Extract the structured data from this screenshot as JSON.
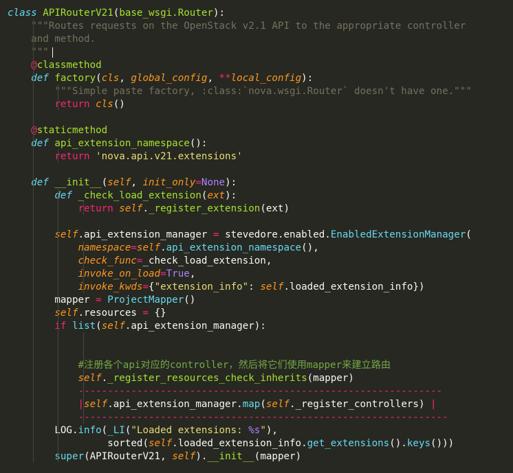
{
  "code_lines": [
    [
      [
        "kw",
        "class"
      ],
      [
        "plain",
        " "
      ],
      [
        "cls",
        "APIRouterV21"
      ],
      [
        "plain",
        "("
      ],
      [
        "cls",
        "base_wsgi.Router"
      ],
      [
        "plain",
        "):"
      ]
    ],
    [
      [
        "plain",
        "    "
      ],
      [
        "doc",
        "\"\"\"Routes requests on the OpenStack v2.1 API to the appropriate controller"
      ]
    ],
    [
      [
        "plain",
        "    "
      ],
      [
        "doc",
        "and method."
      ]
    ],
    [
      [
        "plain",
        "    "
      ],
      [
        "doc",
        "\"\"\""
      ]
    ],
    [
      [
        "plain",
        "    "
      ],
      [
        "deco",
        "@"
      ],
      [
        "decoName",
        "classmethod"
      ]
    ],
    [
      [
        "plain",
        "    "
      ],
      [
        "kw",
        "def"
      ],
      [
        "plain",
        " "
      ],
      [
        "fn",
        "factory"
      ],
      [
        "plain",
        "("
      ],
      [
        "param",
        "cls"
      ],
      [
        "plain",
        ", "
      ],
      [
        "param",
        "global_config"
      ],
      [
        "plain",
        ", "
      ],
      [
        "op",
        "**"
      ],
      [
        "param",
        "local_config"
      ],
      [
        "plain",
        "):"
      ]
    ],
    [
      [
        "plain",
        "        "
      ],
      [
        "doc",
        "\"\"\"Simple paste factory, :class:`nova.wsgi.Router` doesn't have one.\"\"\""
      ]
    ],
    [
      [
        "plain",
        "        "
      ],
      [
        "ctl",
        "return"
      ],
      [
        "plain",
        " "
      ],
      [
        "self",
        "cls"
      ],
      [
        "plain",
        "()"
      ]
    ],
    [],
    [
      [
        "plain",
        "    "
      ],
      [
        "deco",
        "@"
      ],
      [
        "decoName",
        "staticmethod"
      ]
    ],
    [
      [
        "plain",
        "    "
      ],
      [
        "kw",
        "def"
      ],
      [
        "plain",
        " "
      ],
      [
        "fn",
        "api_extension_namespace"
      ],
      [
        "plain",
        "():"
      ]
    ],
    [
      [
        "plain",
        "        "
      ],
      [
        "ctl",
        "return"
      ],
      [
        "plain",
        " "
      ],
      [
        "str",
        "'nova.api.v21.extensions'"
      ]
    ],
    [],
    [
      [
        "plain",
        "    "
      ],
      [
        "kw",
        "def"
      ],
      [
        "plain",
        " "
      ],
      [
        "fn",
        "__init__"
      ],
      [
        "plain",
        "("
      ],
      [
        "param",
        "self"
      ],
      [
        "plain",
        ", "
      ],
      [
        "param",
        "init_only"
      ],
      [
        "op",
        "="
      ],
      [
        "const",
        "None"
      ],
      [
        "plain",
        "):"
      ]
    ],
    [
      [
        "plain",
        "        "
      ],
      [
        "kw",
        "def"
      ],
      [
        "plain",
        " "
      ],
      [
        "fn",
        "_check_load_extension"
      ],
      [
        "plain",
        "("
      ],
      [
        "param",
        "ext"
      ],
      [
        "plain",
        "):"
      ]
    ],
    [
      [
        "plain",
        "            "
      ],
      [
        "ctl",
        "return"
      ],
      [
        "plain",
        " "
      ],
      [
        "self",
        "self"
      ],
      [
        "plain",
        "."
      ],
      [
        "fn",
        "_register_extension"
      ],
      [
        "plain",
        "(ext)"
      ]
    ],
    [],
    [
      [
        "plain",
        "        "
      ],
      [
        "self",
        "self"
      ],
      [
        "plain",
        ".api_extension_manager "
      ],
      [
        "op",
        "="
      ],
      [
        "plain",
        " stevedore.enabled."
      ],
      [
        "method",
        "EnabledExtensionManager"
      ],
      [
        "plain",
        "("
      ]
    ],
    [
      [
        "plain",
        "            "
      ],
      [
        "param",
        "namespace"
      ],
      [
        "op",
        "="
      ],
      [
        "self",
        "self"
      ],
      [
        "plain",
        "."
      ],
      [
        "method",
        "api_extension_namespace"
      ],
      [
        "plain",
        "(),"
      ]
    ],
    [
      [
        "plain",
        "            "
      ],
      [
        "param",
        "check_func"
      ],
      [
        "op",
        "="
      ],
      [
        "plain",
        "_check_load_extension,"
      ]
    ],
    [
      [
        "plain",
        "            "
      ],
      [
        "param",
        "invoke_on_load"
      ],
      [
        "op",
        "="
      ],
      [
        "const",
        "True"
      ],
      [
        "plain",
        ","
      ]
    ],
    [
      [
        "plain",
        "            "
      ],
      [
        "param",
        "invoke_kwds"
      ],
      [
        "op",
        "="
      ],
      [
        "plain",
        "{"
      ],
      [
        "str",
        "\"extension_info\""
      ],
      [
        "plain",
        ": "
      ],
      [
        "self",
        "self"
      ],
      [
        "plain",
        ".loaded_extension_info})"
      ]
    ],
    [
      [
        "plain",
        "        mapper "
      ],
      [
        "op",
        "="
      ],
      [
        "plain",
        " "
      ],
      [
        "method",
        "ProjectMapper"
      ],
      [
        "plain",
        "()"
      ]
    ],
    [
      [
        "plain",
        "        "
      ],
      [
        "self",
        "self"
      ],
      [
        "plain",
        ".resources "
      ],
      [
        "op",
        "="
      ],
      [
        "plain",
        " {}"
      ]
    ],
    [
      [
        "plain",
        "        "
      ],
      [
        "ctl",
        "if"
      ],
      [
        "plain",
        " "
      ],
      [
        "bi",
        "list"
      ],
      [
        "plain",
        "("
      ],
      [
        "self",
        "self"
      ],
      [
        "plain",
        ".api_extension_manager):"
      ]
    ],
    [],
    [],
    [
      [
        "plain",
        "            "
      ],
      [
        "comment",
        "#注册各个api对应的controller，然后将它们使用mapper来建立路由"
      ]
    ],
    [
      [
        "plain",
        "            "
      ],
      [
        "self",
        "self"
      ],
      [
        "plain",
        "."
      ],
      [
        "fn",
        "_register_resources_check_inherits"
      ],
      [
        "plain",
        "(mapper)"
      ]
    ],
    [
      [
        "plain",
        "            "
      ],
      [
        "dash",
        "--------------------------------------------------------------"
      ]
    ],
    [
      [
        "plain",
        "            "
      ],
      [
        "dash",
        "|"
      ],
      [
        "self",
        "self"
      ],
      [
        "plain",
        ".api_extension_manager."
      ],
      [
        "method",
        "map"
      ],
      [
        "plain",
        "("
      ],
      [
        "self",
        "self"
      ],
      [
        "plain",
        "._register_controllers) "
      ],
      [
        "dash",
        "|"
      ]
    ],
    [
      [
        "plain",
        "            "
      ],
      [
        "dash",
        "---------------------------------------------------------------"
      ]
    ],
    [
      [
        "plain",
        "        LOG."
      ],
      [
        "method",
        "info"
      ],
      [
        "plain",
        "("
      ],
      [
        "method",
        "_LI"
      ],
      [
        "plain",
        "("
      ],
      [
        "str",
        "\"Loaded extensions: "
      ],
      [
        "const",
        "%s"
      ],
      [
        "str",
        "\""
      ],
      [
        "plain",
        "),"
      ]
    ],
    [
      [
        "plain",
        "                 sorted("
      ],
      [
        "self",
        "self"
      ],
      [
        "plain",
        ".loaded_extension_info."
      ],
      [
        "method",
        "get_extensions"
      ],
      [
        "plain",
        "()."
      ],
      [
        "method",
        "keys"
      ],
      [
        "plain",
        "()))"
      ]
    ],
    [
      [
        "plain",
        "        "
      ],
      [
        "bi",
        "super"
      ],
      [
        "plain",
        "(APIRouterV21, "
      ],
      [
        "self",
        "self"
      ],
      [
        "plain",
        ")."
      ],
      [
        "fn",
        "__init__"
      ],
      [
        "plain",
        "(mapper)"
      ]
    ]
  ]
}
